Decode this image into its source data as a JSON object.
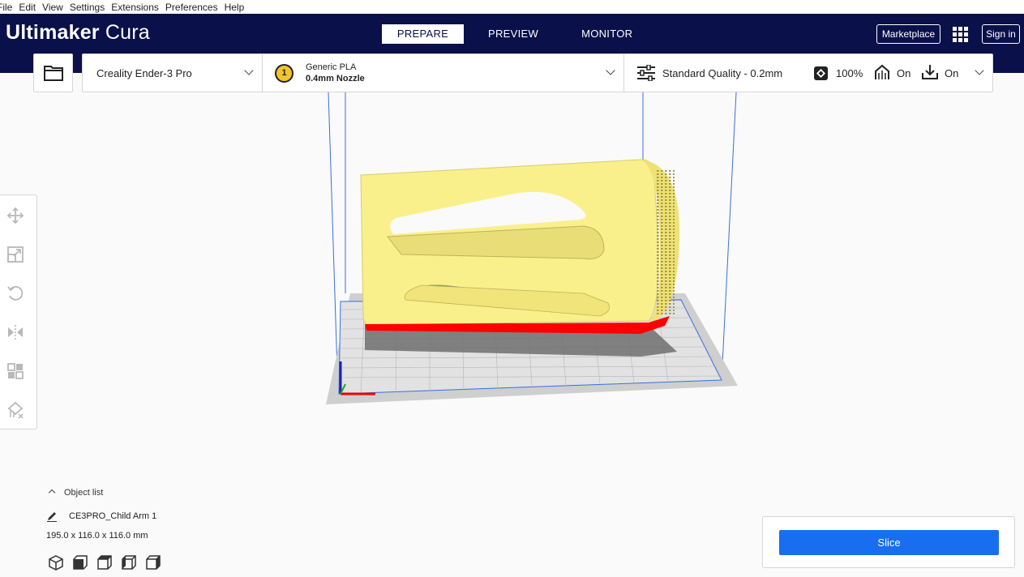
{
  "menu": {
    "items": [
      "File",
      "Edit",
      "View",
      "Settings",
      "Extensions",
      "Preferences",
      "Help"
    ]
  },
  "header": {
    "logo_brand": "Ultimaker",
    "logo_product": "Cura",
    "stages": [
      "PREPARE",
      "PREVIEW",
      "MONITOR"
    ],
    "active_stage": "PREPARE",
    "marketplace_label": "Marketplace",
    "signin_label": "Sign in"
  },
  "config": {
    "printer": "Creality Ender-3 Pro",
    "extruder_number": "1",
    "material": "Generic PLA",
    "nozzle": "0.4mm Nozzle",
    "quality": "Standard Quality - 0.2mm",
    "infill": "100%",
    "support": "On",
    "adhesion": "On"
  },
  "object_list": {
    "header": "Object list",
    "item_name": "CE3PRO_Child Arm 1",
    "dimensions": "195.0 x 116.0 x 116.0 mm"
  },
  "slice": {
    "button_label": "Slice"
  },
  "colors": {
    "header_bg": "#0a1049",
    "accent_blue": "#196ef0",
    "model_yellow": "#f9f08c",
    "overhang_red": "#ff0000",
    "extruder_yellow": "#f3c42e"
  },
  "icons": {
    "tools": [
      "move-icon",
      "scale-icon",
      "rotate-icon",
      "mirror-icon",
      "per-model-settings-icon",
      "support-blocker-icon"
    ],
    "views": [
      "3d-view-icon",
      "front-view-icon",
      "top-view-icon",
      "left-view-icon",
      "right-view-icon"
    ]
  }
}
